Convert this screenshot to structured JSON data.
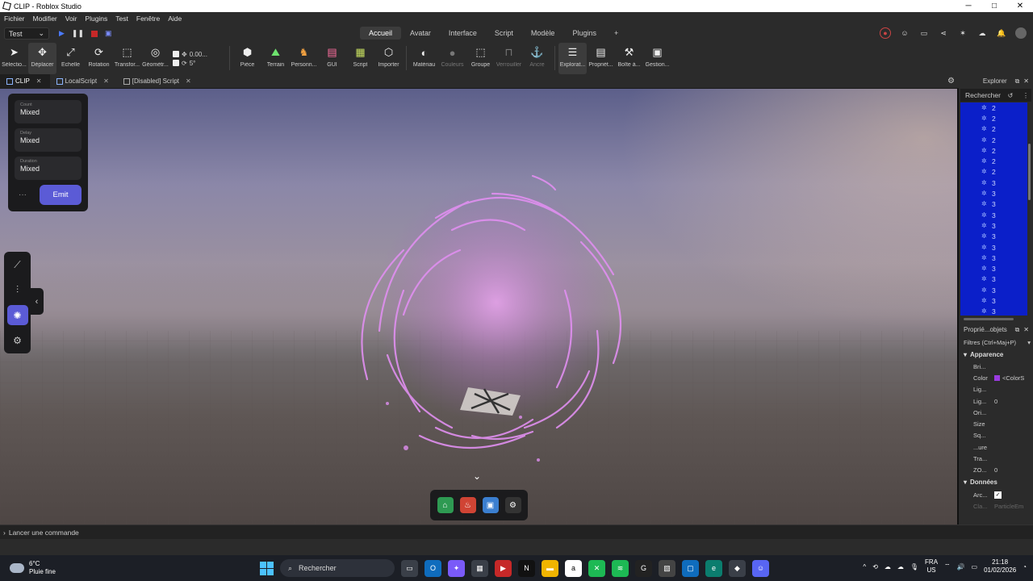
{
  "window": {
    "title": "CLIP - Roblox Studio",
    "controls": [
      "─",
      "□",
      "✕"
    ]
  },
  "menu": [
    "Fichier",
    "Modifier",
    "Voir",
    "Plugins",
    "Test",
    "Fenêtre",
    "Aide"
  ],
  "mode": {
    "value": "Test"
  },
  "ribbon_tabs": [
    {
      "label": "Accueil",
      "active": true
    },
    {
      "label": "Avatar"
    },
    {
      "label": "Interface"
    },
    {
      "label": "Script"
    },
    {
      "label": "Modèle"
    },
    {
      "label": "Plugins"
    },
    {
      "label": "+"
    }
  ],
  "toolbar": {
    "tools": [
      {
        "label": "Sélectio...",
        "icon": "cursor-icon",
        "glyph": "➤"
      },
      {
        "label": "Déplacer",
        "icon": "move-icon",
        "glyph": "✥",
        "active": true
      },
      {
        "label": "Échelle",
        "icon": "scale-icon",
        "glyph": "⤢"
      },
      {
        "label": "Rotation",
        "icon": "rotate-icon",
        "glyph": "⟳"
      },
      {
        "label": "Transfor...",
        "icon": "transform-icon",
        "glyph": "⬚"
      },
      {
        "label": "Géométr...",
        "icon": "geometry-icon",
        "glyph": "◎"
      }
    ],
    "snap": {
      "move": "0.00...",
      "rotate": "5°"
    },
    "tools2": [
      {
        "label": "Pièce",
        "icon": "part-icon",
        "glyph": "⬢"
      },
      {
        "label": "Terrain",
        "icon": "terrain-icon",
        "glyph": "⛰"
      },
      {
        "label": "Personn...",
        "icon": "character-icon",
        "glyph": "♞"
      },
      {
        "label": "GUI",
        "icon": "gui-icon",
        "glyph": "▤"
      },
      {
        "label": "Script",
        "icon": "script-icon",
        "glyph": "▦"
      },
      {
        "label": "Importer",
        "icon": "import-icon",
        "glyph": "⬡"
      },
      {
        "label": "Matériau",
        "icon": "material-icon",
        "glyph": "◐"
      },
      {
        "label": "Couleurs",
        "icon": "color-icon",
        "glyph": "●",
        "dim": true
      },
      {
        "label": "Groupe",
        "icon": "group-icon",
        "glyph": "⬚"
      },
      {
        "label": "Verrouiller",
        "icon": "lock-icon",
        "glyph": "🔒",
        "dim": true
      },
      {
        "label": "Ancre",
        "icon": "anchor-icon",
        "glyph": "⚓",
        "dim": true
      },
      {
        "label": "Explorat...",
        "icon": "explorer-icon",
        "glyph": "☰",
        "active": true
      },
      {
        "label": "Propriét...",
        "icon": "properties-icon",
        "glyph": "▤"
      },
      {
        "label": "Boîte à...",
        "icon": "toolbox-icon",
        "glyph": "⚒"
      },
      {
        "label": "Gestion...",
        "icon": "asset-manager-icon",
        "glyph": "▣"
      }
    ]
  },
  "doc_tabs": [
    {
      "label": "CLIP",
      "active": true
    },
    {
      "label": "LocalScript"
    },
    {
      "label": "[Disabled] Script"
    }
  ],
  "emitter": {
    "fields": [
      {
        "label": "Count",
        "value": "Mixed"
      },
      {
        "label": "Delay",
        "value": "Mixed"
      },
      {
        "label": "Duration",
        "value": "Mixed"
      }
    ],
    "more": "···",
    "emit_label": "Emit"
  },
  "command": {
    "placeholder": "Lancer une commande"
  },
  "explorer": {
    "title": "Explorer",
    "search": "Rechercher",
    "items": [
      "2",
      "2",
      "2",
      "2",
      "2",
      "2",
      "2",
      "3",
      "3",
      "3",
      "3",
      "3",
      "3",
      "3",
      "3",
      "3",
      "3",
      "3",
      "3",
      "3"
    ]
  },
  "properties": {
    "title": "Proprié...objets",
    "filter": "Filtres (Ctrl+Maj+P)",
    "sections": [
      {
        "name": "Apparence",
        "props": [
          {
            "name": "Bri...",
            "value": ""
          },
          {
            "name": "Color",
            "value": "<ColorS",
            "swatch": "#9a3be0"
          },
          {
            "name": "Lig...",
            "value": ""
          },
          {
            "name": "Lig...",
            "value": "0"
          },
          {
            "name": "Ori...",
            "value": ""
          },
          {
            "name": "Size",
            "value": ""
          },
          {
            "name": "Sq...",
            "value": ""
          },
          {
            "name": "...ure",
            "value": ""
          },
          {
            "name": "Tra...",
            "value": ""
          },
          {
            "name": "ZO...",
            "value": "0"
          }
        ]
      },
      {
        "name": "Données",
        "props": [
          {
            "name": "Arc...",
            "value": "",
            "checkbox": true
          },
          {
            "name": "Cla...",
            "value": "ParticleEm",
            "dim": true
          }
        ]
      }
    ]
  },
  "taskbar": {
    "weather_temp": "6°C",
    "weather_desc": "Pluie fine",
    "search": "Rechercher",
    "lang1": "FRA",
    "lang2": "US",
    "time": "21:18",
    "date": "01/02/2026"
  },
  "colors": {
    "accent": "#5b5bd6",
    "explorer_select": "#0b1fc9",
    "particle": "#d98ae8"
  }
}
